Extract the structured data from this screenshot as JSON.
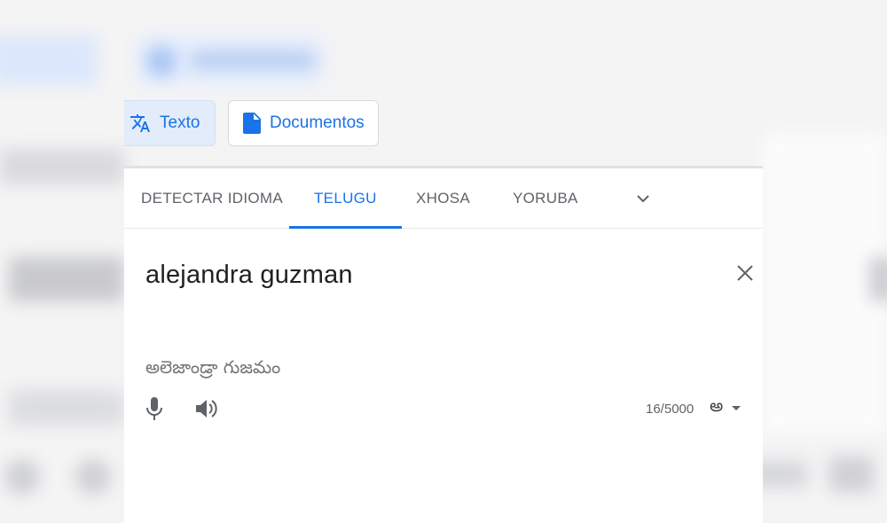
{
  "modes": {
    "text_label": "Texto",
    "documents_label": "Documentos"
  },
  "languages": {
    "tabs": [
      "DETECTAR IDIOMA",
      "TELUGU",
      "XHOSA",
      "YORUBA"
    ],
    "active": "TELUGU"
  },
  "input": {
    "source_text": "alejandra guzman",
    "transliteration": "అలెజాండ్రా గుజమం",
    "char_count": "16/5000",
    "ime_symbol": "అ"
  },
  "colors": {
    "accent": "#1a73e8",
    "text": "#202124",
    "muted": "#5f6368"
  },
  "icons": {
    "text_mode": "translate-icon",
    "documents_mode": "document-icon",
    "more_languages": "chevron-down-icon",
    "clear": "close-icon",
    "microphone": "microphone-icon",
    "listen": "speaker-icon"
  }
}
